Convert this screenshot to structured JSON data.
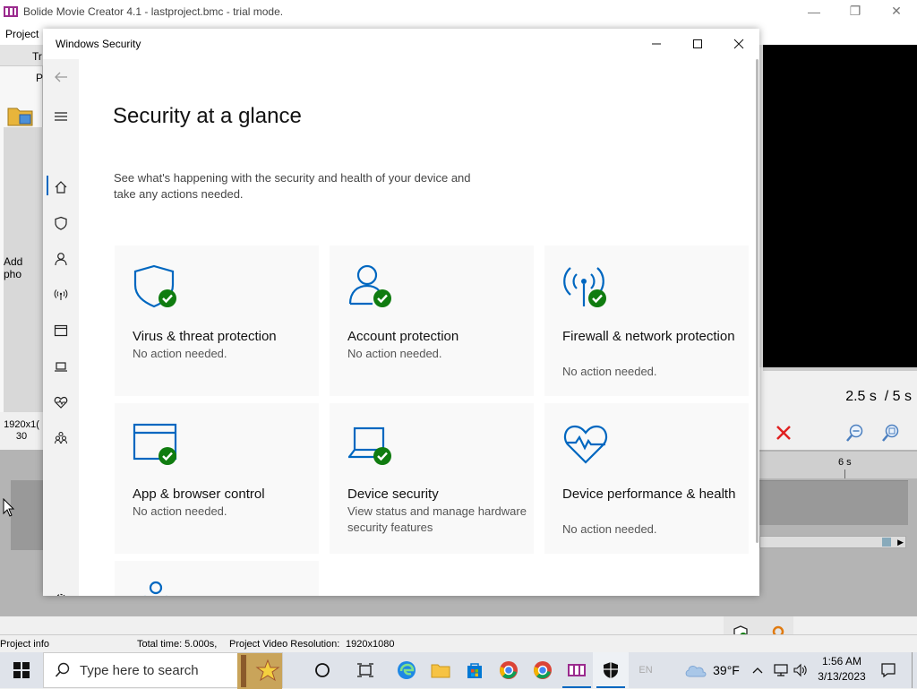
{
  "app": {
    "title": "Bolide Movie Creator 4.1 - lastproject.bmc  - trial mode.",
    "menu_project": "Project",
    "tab_tr": "Tr",
    "tab_p": "P",
    "add_photo_text": "Add pho",
    "resolution_line1": "1920x1(",
    "resolution_line2": "30",
    "time_current": "2.5 s",
    "time_total": "/ 5 s",
    "ruler_label": "6 s",
    "status_project_info": "Project info",
    "status_total_time": "Total time: 5.000s,",
    "status_resolution": "Project Video Resolution:",
    "status_resolution_value": "1920x1080"
  },
  "security": {
    "window_title": "Windows Security",
    "page_title": "Security at a glance",
    "page_subtitle": "See what's happening with the security and health of your device and take any actions needed.",
    "tiles": [
      {
        "name": "Virus & threat protection",
        "status": "No action needed.",
        "icon": "shield-icon"
      },
      {
        "name": "Account protection",
        "status": "No action needed.",
        "icon": "person-icon"
      },
      {
        "name": "Firewall & network protection",
        "status": "No action needed.",
        "icon": "antenna-icon"
      },
      {
        "name": "App & browser control",
        "status": "No action needed.",
        "icon": "browser-window-icon"
      },
      {
        "name": "Device security",
        "status": "View status and manage hardware security features",
        "icon": "laptop-icon"
      },
      {
        "name": "Device performance & health",
        "status": "No action needed.",
        "icon": "heart-pulse-icon"
      },
      {
        "name": "",
        "status": "",
        "icon": "family-icon"
      }
    ],
    "accent_color": "#0067c0",
    "ok_color": "#107c10"
  },
  "taskbar": {
    "search_placeholder": "Type here to search",
    "language": "EN",
    "temperature": "39°F",
    "time": "1:56 AM",
    "date": "3/13/2023"
  }
}
